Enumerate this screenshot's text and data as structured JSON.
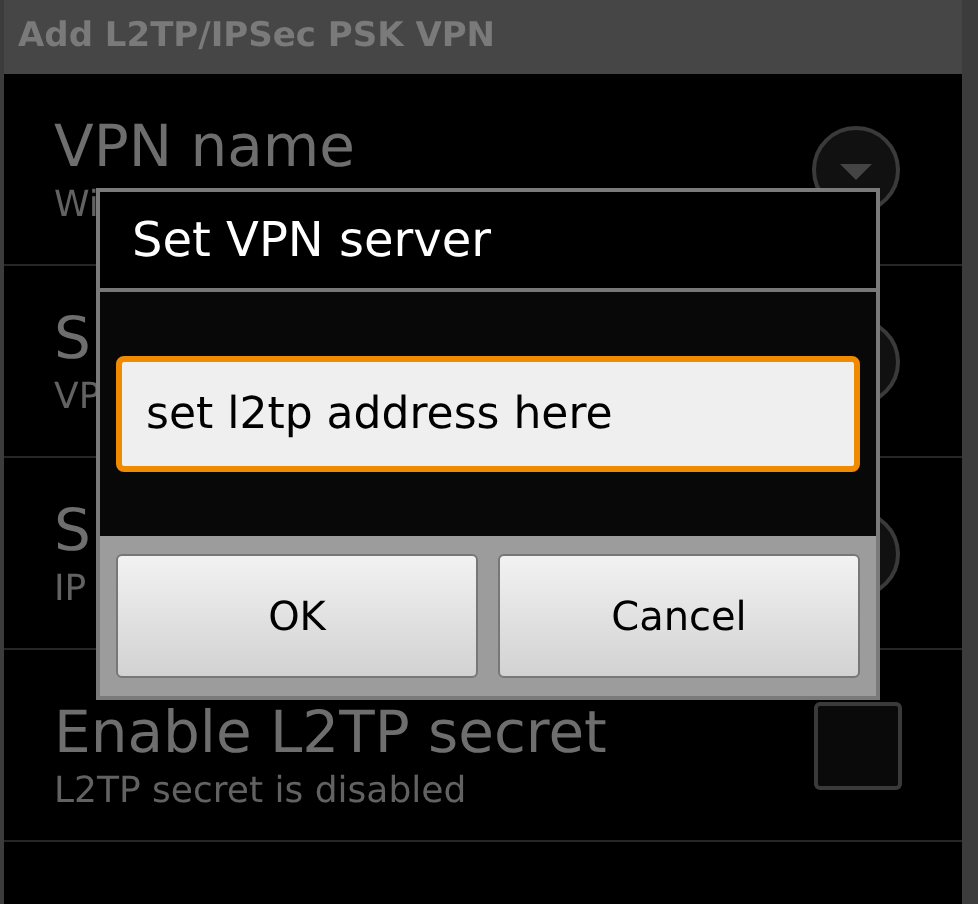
{
  "window": {
    "title": "Add L2TP/IPSec PSK VPN"
  },
  "settings": [
    {
      "title": "VPN name",
      "summary": "Wi",
      "kind": "dropdown"
    },
    {
      "title": "S",
      "summary": "VP",
      "kind": "dropdown"
    },
    {
      "title": "S",
      "summary": "IP",
      "kind": "dropdown"
    },
    {
      "title": "Enable L2TP secret",
      "summary": "L2TP secret is disabled",
      "kind": "checkbox",
      "checked": false
    }
  ],
  "dialog": {
    "title": "Set VPN server",
    "field": {
      "value": "set l2tp address here",
      "focused": true
    },
    "buttons": [
      "OK",
      "Cancel"
    ]
  }
}
